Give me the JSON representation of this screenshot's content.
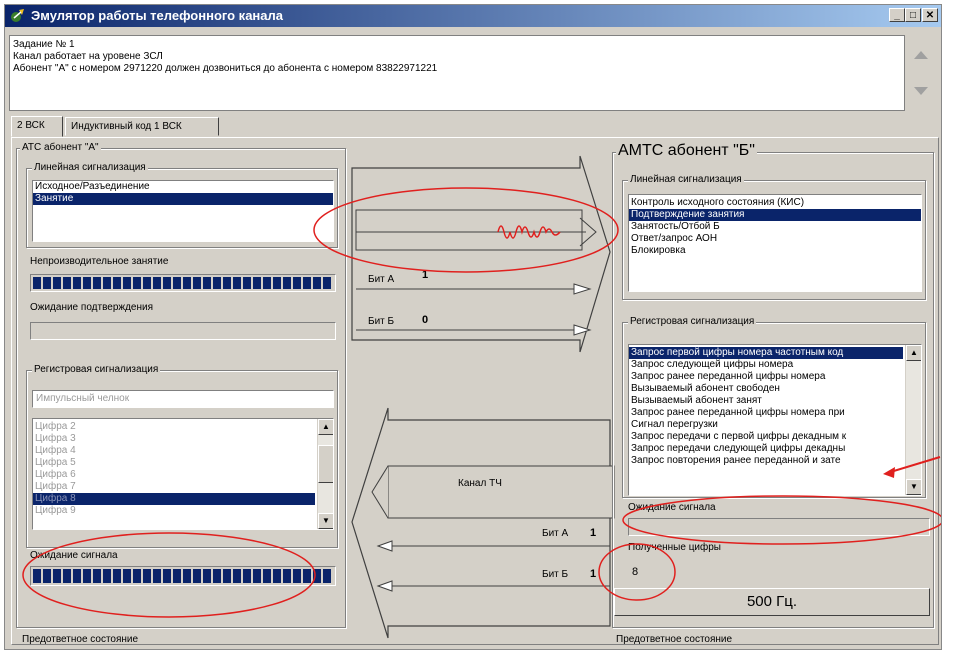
{
  "window": {
    "title": "Эмулятор работы телефонного канала"
  },
  "task": {
    "lines": [
      "Задание № 1",
      "Канал работает на уровене ЗСЛ",
      "Абонент \"А\" с номером 2971220 должен дозвониться до абонента с номером 83822971221"
    ]
  },
  "tabs": [
    {
      "label": "2 ВСК",
      "active": true
    },
    {
      "label": "Индуктивный код 1 ВСК",
      "active": false
    }
  ],
  "left": {
    "group_title": "АТС  абонент \"А\"",
    "line_signaling": {
      "title": "Линейная сигнализация",
      "items": [
        "Исходное/Разъединение",
        "Занятие"
      ],
      "selected": "Занятие"
    },
    "unproductive_label": "Непроизводительное занятие",
    "unproductive_progress": 1.0,
    "confirm_wait_label": "Ожидание подтверждения",
    "confirm_wait_progress": 0.0,
    "register_signaling": {
      "title": "Регистровая сигнализация",
      "mode_placeholder": "Импульсный челнок",
      "digits": [
        "Цифра 2",
        "Цифра 3",
        "Цифра 4",
        "Цифра 5",
        "Цифра 6",
        "Цифра 7",
        "Цифра 8",
        "Цифра 9"
      ],
      "selected": "Цифра 8"
    },
    "signal_wait_label": "Ожидание сигнала",
    "signal_wait_progress": 1.0,
    "status": "Предответное состояние"
  },
  "channel": {
    "bit_a_forward_label": "Бит А",
    "bit_a_forward_value": "1",
    "bit_b_forward_label": "Бит Б",
    "bit_b_forward_value": "0",
    "channel_label": "Канал ТЧ",
    "bit_a_backward_label": "Бит А",
    "bit_a_backward_value": "1",
    "bit_b_backward_label": "Бит Б",
    "bit_b_backward_value": "1"
  },
  "right": {
    "group_title": "АМТС  абонент \"Б\"",
    "line_signaling": {
      "title": "Линейная сигнализация",
      "items": [
        "Контроль исходного состояния (КИС)",
        "Подтверждение занятия",
        "Занятость/Отбой Б",
        "Ответ/запрос АОН",
        "Блокировка"
      ],
      "selected": "Подтверждение занятия"
    },
    "register_signaling": {
      "title": "Регистровая сигнализация",
      "items": [
        "Запрос первой цифры номера частотным код",
        "Запрос следующей цифры номера",
        "Запрос ранее переданной цифры номера",
        "Вызываемый абонент свободен",
        "Вызываемый абонент занят",
        "Запрос ранее переданной цифры номера при",
        "Сигнал перегрузки",
        "Запрос передачи с первой цифры декадным к",
        "Запрос передачи следующей цифры декадны",
        "Запрос повторения ранее переданной и зате"
      ],
      "selected": "Запрос первой цифры номера частотным код"
    },
    "signal_wait_label": "Ожидание сигнала",
    "signal_wait_progress": 0.0,
    "received_digits_label": "Полученные цифры",
    "received_digits_value": "8",
    "freq_button": "500 Гц.",
    "status": "Предответное состояние"
  },
  "colors": {
    "selection": "#0a246a",
    "progress": "#0a246a",
    "annotation": "#e0201e",
    "face": "#d4d0c8"
  }
}
